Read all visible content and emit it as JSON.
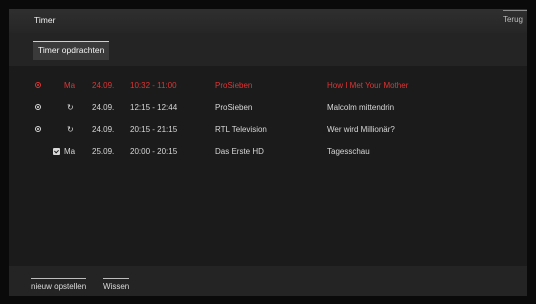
{
  "header": {
    "title": "Timer",
    "back_label": "Terug"
  },
  "tabs": {
    "active_label": "Timer opdrachten"
  },
  "timers": [
    {
      "icon": "record-dot-icon",
      "day": "Ma",
      "date": "24.09.",
      "time": "10:32 - 11:00",
      "channel": "ProSieben",
      "title": "How I Met Your Mother",
      "active": true
    },
    {
      "icon": "record-dot-icon",
      "repeat_icon": "repeat-icon",
      "day": "",
      "date": "24.09.",
      "time": "12:15 - 12:44",
      "channel": "ProSieben",
      "title": "Malcolm mittendrin",
      "active": false
    },
    {
      "icon": "record-dot-icon",
      "repeat_icon": "repeat-icon",
      "day": "",
      "date": "24.09.",
      "time": "20:15 - 21:15",
      "channel": "RTL Television",
      "title": "Wer wird Millionär?",
      "active": false
    },
    {
      "icon": "checkbox-icon",
      "day": "Ma",
      "date": "25.09.",
      "time": "20:00 - 20:15",
      "channel": "Das Erste HD",
      "title": "Tagesschau",
      "active": false
    }
  ],
  "footer": {
    "new_label": "nieuw opstellen",
    "delete_label": "Wissen"
  },
  "colors": {
    "accent": "#e03535",
    "background": "#1b1b1b",
    "text": "#d8d8d8"
  }
}
